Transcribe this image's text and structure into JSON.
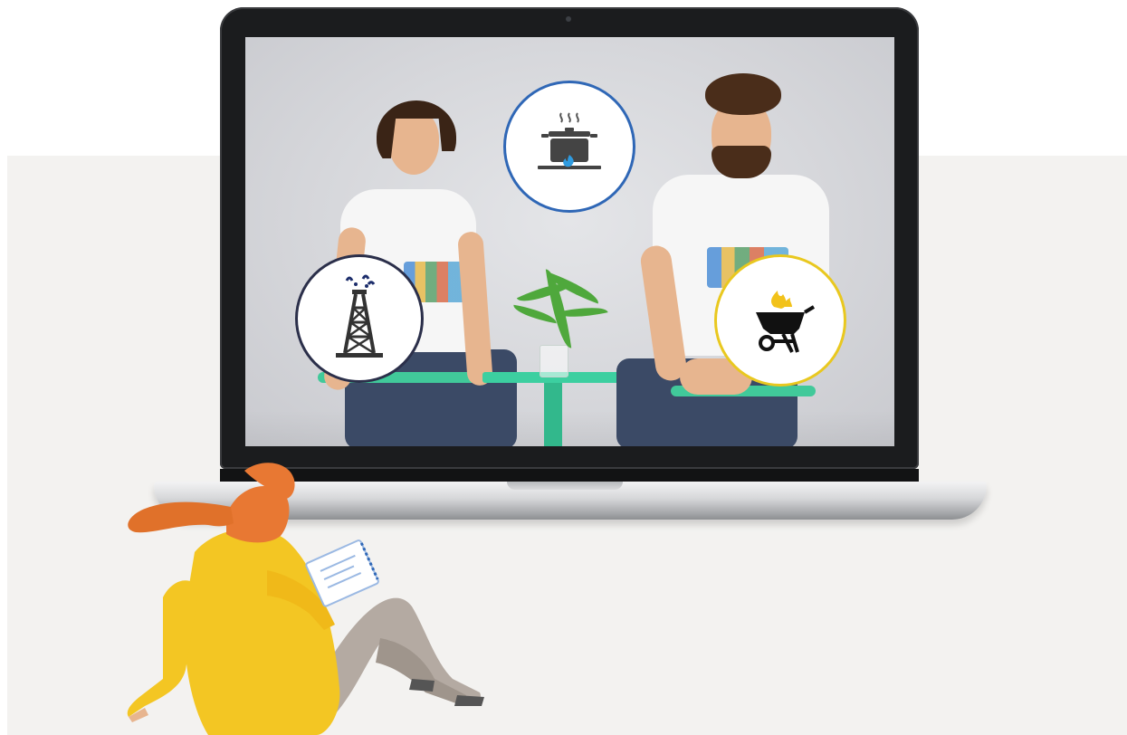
{
  "colors": {
    "page_background": "#ffffff",
    "band_background": "#f3f2f0",
    "pot_ring": "#2f67b6",
    "rig_ring": "#2b2f4a",
    "bbq_ring": "#e9c81f",
    "flame": "#f2c21a",
    "hair": "#e0712a",
    "sweater": "#f3c623",
    "trousers": "#b4aaa2"
  },
  "icons": [
    "cooking-pot-on-gas-stove-icon",
    "oil-derrick-icon",
    "barbecue-grill-icon"
  ]
}
